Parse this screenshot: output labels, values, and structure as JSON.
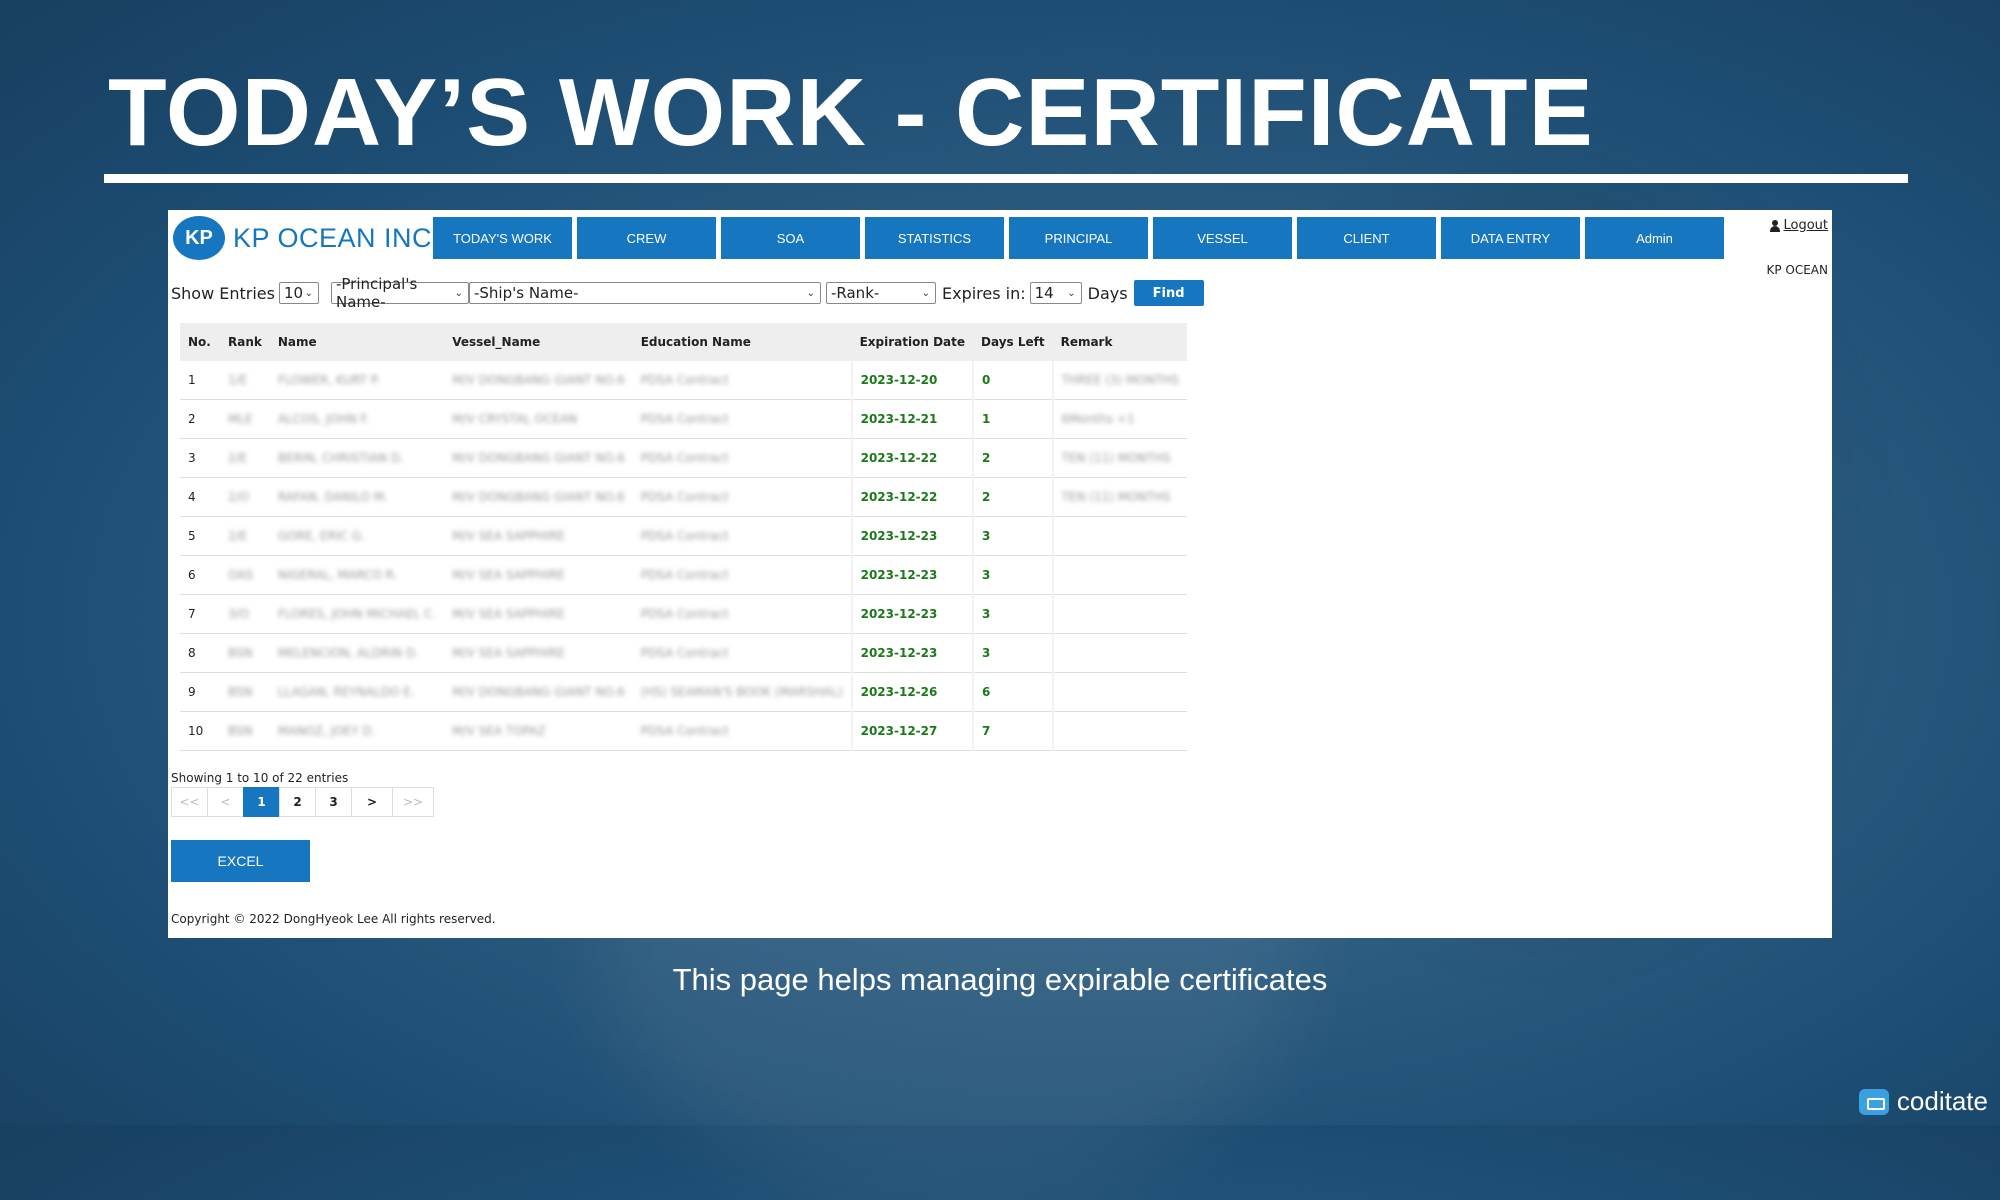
{
  "slide": {
    "title": "TODAY’S WORK - CERTIFICATE",
    "caption": "This page helps managing expirable certificates",
    "brand": "coditate"
  },
  "app": {
    "logo_mark": "KP",
    "logo_text": "KP OCEAN INC",
    "nav": [
      "TODAY'S WORK",
      "CREW",
      "SOA",
      "STATISTICS",
      "PRINCIPAL",
      "VESSEL",
      "CLIENT",
      "DATA ENTRY",
      "Admin"
    ],
    "logout": "Logout",
    "org": "KP OCEAN"
  },
  "filters": {
    "show_entries_label": "Show Entries",
    "show_entries_value": "10",
    "principal": "-Principal's Name-",
    "ship": "-Ship's Name-",
    "rank": "-Rank-",
    "expires_label": "Expires in:",
    "expires_value": "14",
    "days_label": "Days",
    "find": "Find"
  },
  "table": {
    "headers": [
      "No.",
      "Rank",
      "Name",
      "Vessel_Name",
      "Education Name",
      "Expiration Date",
      "Days Left",
      "Remark"
    ],
    "rows": [
      {
        "no": "1",
        "rank": "1/E",
        "name": "FLOWER, KURT P.",
        "vessel": "M/V DONGBANG GIANT NO.6",
        "education": "PDSA Contract",
        "date": "2023-12-20",
        "days": "0",
        "remark": "THREE (3) MONTHS"
      },
      {
        "no": "2",
        "rank": "MLE",
        "name": "ALCOS, JOHN F.",
        "vessel": "M/V CRYSTAL OCEAN",
        "education": "PDSA Contract",
        "date": "2023-12-21",
        "days": "1",
        "remark": "6Months +1"
      },
      {
        "no": "3",
        "rank": "2/E",
        "name": "BERIN, CHRISTIAN D.",
        "vessel": "M/V DONGBANG GIANT NO.6",
        "education": "PDSA Contract",
        "date": "2023-12-22",
        "days": "2",
        "remark": "TEN (11) MONTHS"
      },
      {
        "no": "4",
        "rank": "2/O",
        "name": "RAFAN, DANILO M.",
        "vessel": "M/V DONGBANG GIANT NO.6",
        "education": "PDSA Contract",
        "date": "2023-12-22",
        "days": "2",
        "remark": "TEN (11) MONTHS"
      },
      {
        "no": "5",
        "rank": "2/E",
        "name": "GORE, ERIC G.",
        "vessel": "M/V SEA SAPPHIRE",
        "education": "PDSA Contract",
        "date": "2023-12-23",
        "days": "3",
        "remark": ""
      },
      {
        "no": "6",
        "rank": "OAS",
        "name": "NIGERAL, MARCO R.",
        "vessel": "M/V SEA SAPPHIRE",
        "education": "PDSA Contract",
        "date": "2023-12-23",
        "days": "3",
        "remark": ""
      },
      {
        "no": "7",
        "rank": "3/O",
        "name": "FLORES, JOHN MICHAEL C.",
        "vessel": "M/V SEA SAPPHIRE",
        "education": "PDSA Contract",
        "date": "2023-12-23",
        "days": "3",
        "remark": ""
      },
      {
        "no": "8",
        "rank": "BSN",
        "name": "MELENCION, ALDRIN D.",
        "vessel": "M/V SEA SAPPHIRE",
        "education": "PDSA Contract",
        "date": "2023-12-23",
        "days": "3",
        "remark": ""
      },
      {
        "no": "9",
        "rank": "BSN",
        "name": "LLAGAN, REYNALDO E.",
        "vessel": "M/V DONGBANG GIANT NO.6",
        "education": "(HS) SEAMAN'S BOOK (MARSHAL)",
        "date": "2023-12-26",
        "days": "6",
        "remark": ""
      },
      {
        "no": "10",
        "rank": "BSN",
        "name": "MANOZ, JOEY D.",
        "vessel": "M/V SEA TOPAZ",
        "education": "PDSA Contract",
        "date": "2023-12-27",
        "days": "7",
        "remark": ""
      }
    ]
  },
  "footer": {
    "showing": "Showing 1 to 10 of 22 entries",
    "pager": [
      "<<",
      "<",
      "1",
      "2",
      "3",
      ">",
      ">>"
    ],
    "active_page": "1",
    "excel": "EXCEL",
    "copyright": "Copyright © 2022 DongHyeok Lee All rights reserved."
  },
  "colors": {
    "accent": "#1677c0",
    "days_green": "#1a7a1a"
  }
}
